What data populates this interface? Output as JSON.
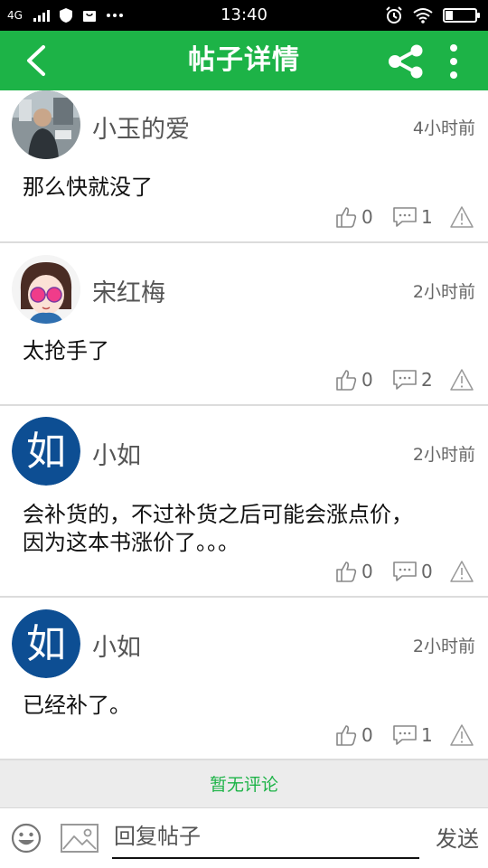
{
  "status_bar": {
    "network": "4G",
    "time": "13:40"
  },
  "header": {
    "title": "帖子详情",
    "back_icon": "chevron-left-icon",
    "share_icon": "share-icon",
    "more_icon": "more-vertical-icon"
  },
  "posts": [
    {
      "username": "小玉的爱",
      "time": "4小时前",
      "content": "那么快就没了",
      "likes": "0",
      "comments": "1"
    },
    {
      "username": "宋红梅",
      "time": "2小时前",
      "content": "太抢手了",
      "likes": "0",
      "comments": "2"
    },
    {
      "username": "小如",
      "avatar_text": "如",
      "time": "2小时前",
      "content": "会补货的，不过补货之后可能会涨点价，因为这本书涨价了。。。",
      "likes": "0",
      "comments": "0"
    },
    {
      "username": "小如",
      "avatar_text": "如",
      "time": "2小时前",
      "content": "已经补了。",
      "likes": "0",
      "comments": "1"
    }
  ],
  "no_comment_text": "暂无评论",
  "reply_bar": {
    "placeholder": "回复帖子",
    "send_label": "发送"
  },
  "colors": {
    "accent": "#1db347",
    "avatar_blue": "#0d4e93"
  }
}
